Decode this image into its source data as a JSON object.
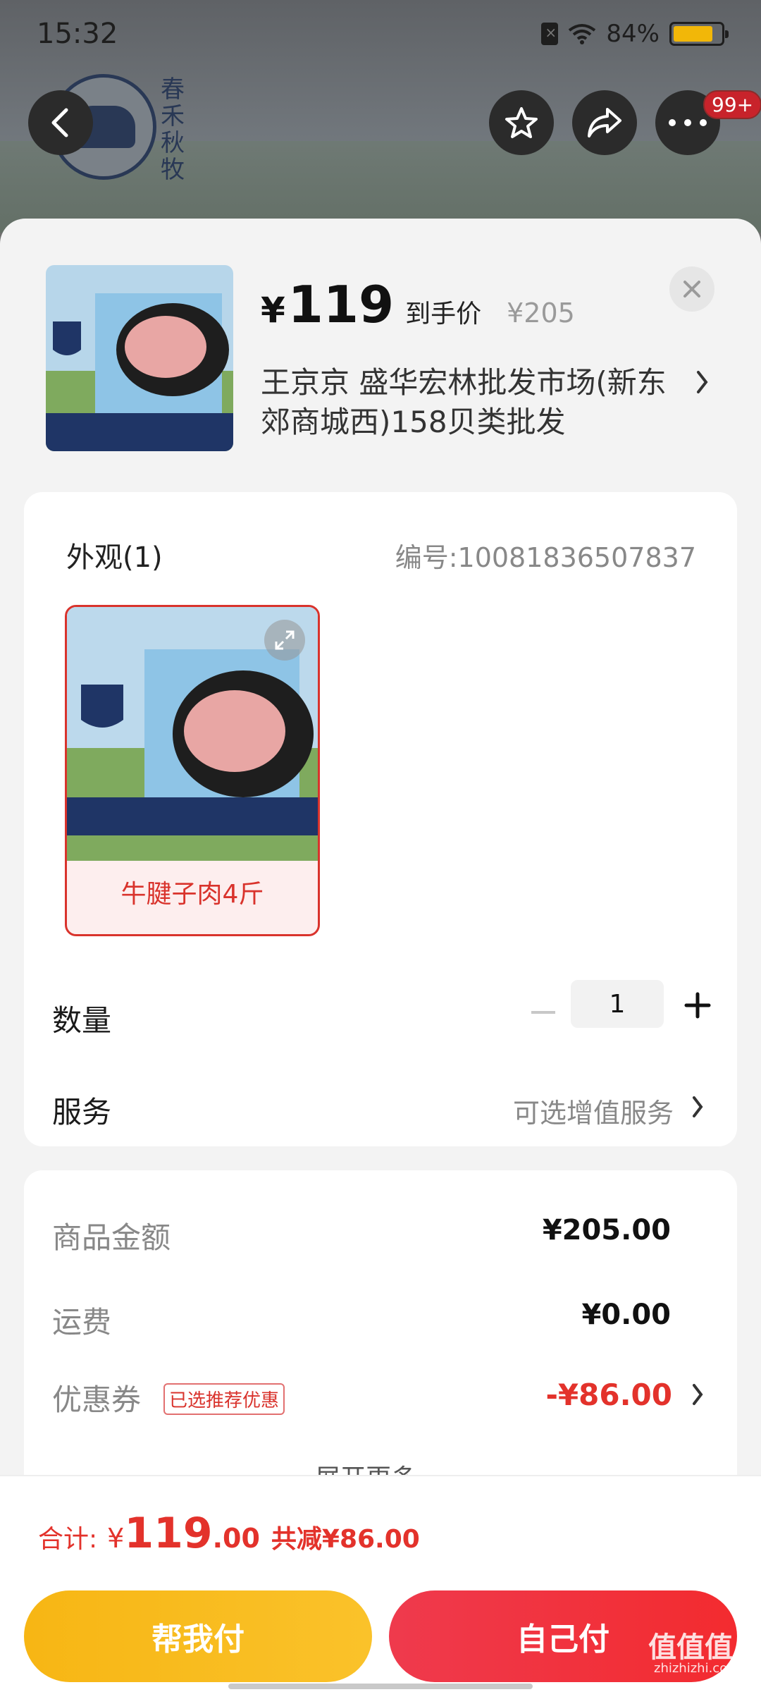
{
  "status_bar": {
    "time": "15:32",
    "battery": "84%",
    "battery_level": 0.84
  },
  "header": {
    "brand": "春禾秋牧",
    "badge": "99+"
  },
  "product": {
    "price_symbol": "¥",
    "price": "119",
    "price_tag": "到手价",
    "original_price": "¥205",
    "shop": "王京京  盛华宏林批发市场(新东郊商城西)158贝类批发"
  },
  "spec": {
    "appearance_title": "外观(1)",
    "sku_code": "编号:10081836507837",
    "variant_label": "牛腱子肉4斤",
    "quantity_label": "数量",
    "quantity_value": "1",
    "service_label": "服务",
    "service_value": "可选增值服务"
  },
  "summary": {
    "goods_label": "商品金额",
    "goods_value": "¥205.00",
    "shipping_label": "运费",
    "shipping_value": "¥0.00",
    "coupon_label": "优惠券",
    "coupon_tag": "已选推荐优惠",
    "coupon_value": "-¥86.00",
    "expand_label": "展开更多"
  },
  "footer": {
    "total_label": "合计:",
    "total_symbol": "¥",
    "total_int": "119",
    "total_dec": ".00",
    "total_save": "共减¥86.00",
    "help_pay_label": "帮我付",
    "self_pay_label": "自己付"
  },
  "watermark": {
    "text": "值值值",
    "sub": "zhizhizhi.com"
  },
  "colors": {
    "accent_red": "#e3322b",
    "pay_yellow": "#f7b614",
    "pay_red": "#f32b2f"
  }
}
